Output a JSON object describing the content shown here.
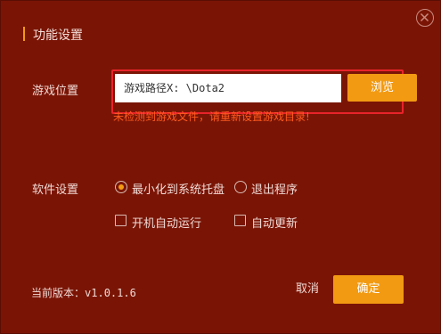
{
  "dialog": {
    "title": "功能设置",
    "accent_color": "#f29a12",
    "background_color": "#7a1506",
    "close_icon": "close-icon"
  },
  "game_location": {
    "label": "游戏位置",
    "path_value": "游戏路径X: \\Dota2",
    "browse_label": "浏览",
    "error_message": "未检测到游戏文件，请重新设置游戏目录!",
    "error_color": "#ff5a1e",
    "highlight_color": "#e8232a"
  },
  "software_settings": {
    "label": "软件设置",
    "close_behavior": [
      {
        "label": "最小化到系统托盘",
        "selected": true
      },
      {
        "label": "退出程序",
        "selected": false
      }
    ],
    "toggles": [
      {
        "label": "开机自动运行",
        "checked": false
      },
      {
        "label": "自动更新",
        "checked": false
      }
    ]
  },
  "footer": {
    "version_label": "当前版本：",
    "version_number": "v1.0.1.6",
    "cancel_label": "取消",
    "ok_label": "确定"
  }
}
